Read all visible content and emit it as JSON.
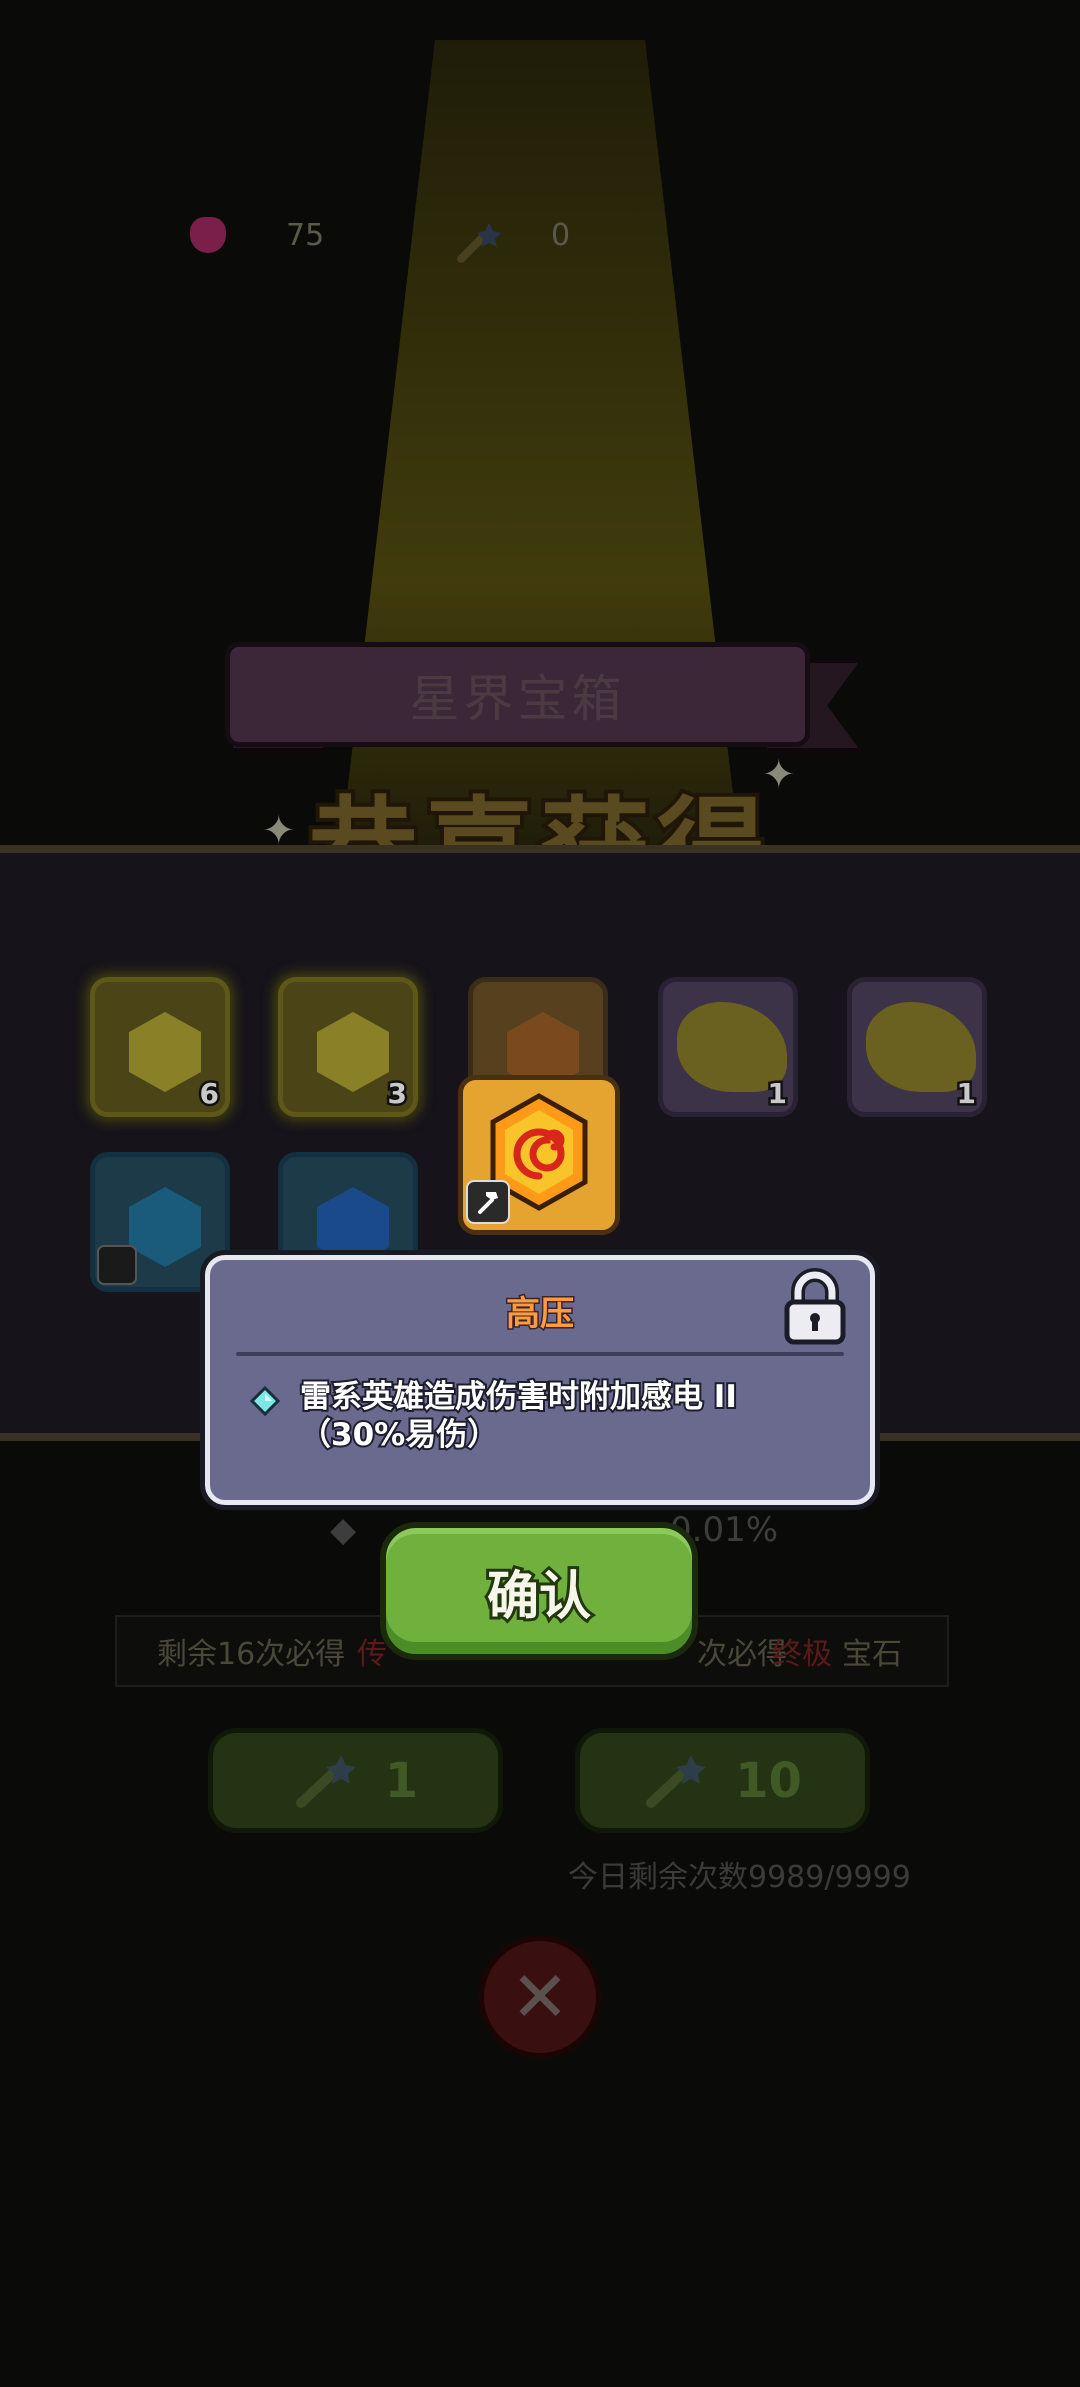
{
  "currency": {
    "gems": "75",
    "wands": "0"
  },
  "chest": {
    "title": "星界宝箱"
  },
  "congrats_text": "恭喜获得",
  "rewards": [
    {
      "type": "gold",
      "count": "6"
    },
    {
      "type": "gold",
      "count": "3"
    },
    {
      "type": "orange",
      "count": ""
    },
    {
      "type": "purple",
      "count": "1"
    },
    {
      "type": "purple",
      "count": "1"
    },
    {
      "type": "blue",
      "count": ""
    },
    {
      "type": "blue",
      "count": ""
    }
  ],
  "odds": {
    "value": "0.01%"
  },
  "pity": {
    "left_prefix": "剩余16次必得",
    "left_highlight": "传",
    "right_prefix": "次必得",
    "right_highlight": "终极",
    "right_suffix": "宝石"
  },
  "draw_buttons": {
    "single": "1",
    "ten": "10"
  },
  "daily_remaining": "今日剩余次数9989/9999",
  "confirm_label": "确认",
  "tooltip": {
    "title": "高压",
    "description": "雷系英雄造成伤害时附加感电 II（30%易伤）"
  },
  "colors": {
    "confirm_green": "#6fb13c",
    "tooltip_bg": "#6a6a8e",
    "title_orange": "#ff9c3a",
    "featured_gold": "#e5a330"
  }
}
